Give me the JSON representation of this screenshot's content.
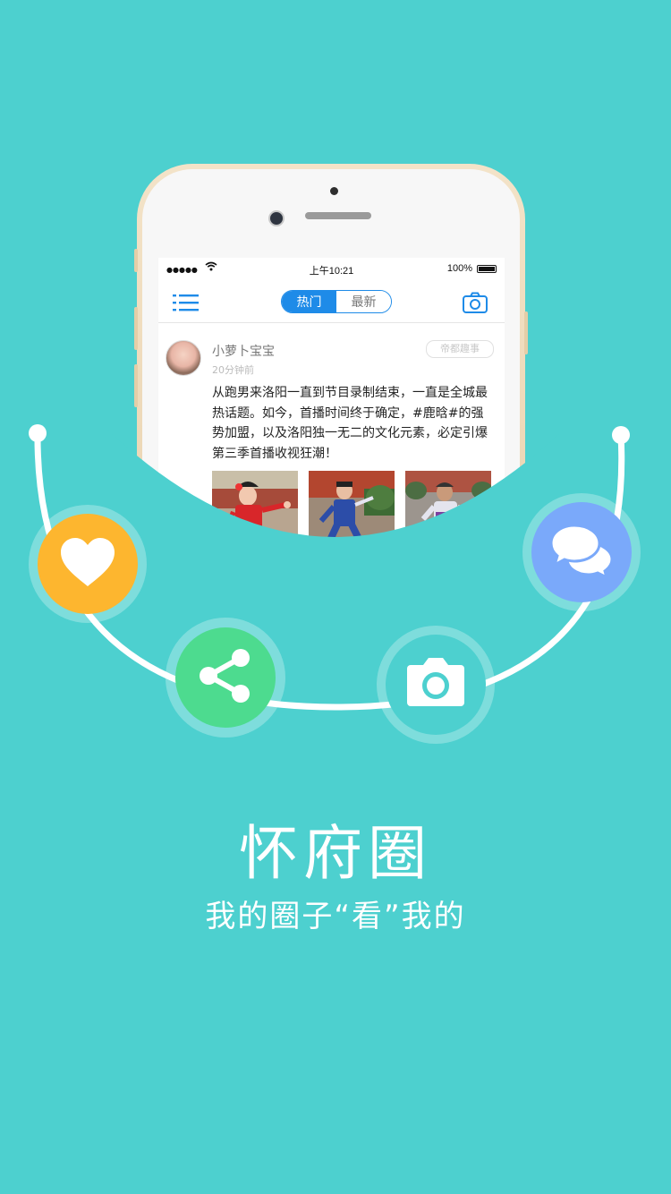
{
  "colors": {
    "background": "#4DD0CF",
    "accent_blue": "#1E8BE8",
    "heart": "#FDB62F",
    "share": "#4DDB8F",
    "chat": "#7AA9FA"
  },
  "status_bar": {
    "signal": "●●●●●",
    "wifi_icon": "wifi-icon",
    "time": "上午10:21",
    "battery": "100%"
  },
  "navbar": {
    "menu_icon": "list-icon",
    "tabs": [
      {
        "label": "热门",
        "active": true
      },
      {
        "label": "最新",
        "active": false
      }
    ],
    "camera_icon": "camera-icon"
  },
  "post": {
    "username": "小萝卜宝宝",
    "time": "20分钟前",
    "tag": "帝都趣事",
    "text": "从跑男来洛阳一直到节目录制结束，一直是全城最热话题。如今，首播时间终于确定，#鹿晗#的强势加盟，以及洛阳独一无二的文化元素，必定引爆第三季首播收视狂潮！"
  },
  "features": [
    {
      "icon": "heart-icon"
    },
    {
      "icon": "share-icon"
    },
    {
      "icon": "camera-icon"
    },
    {
      "icon": "chat-bubbles-icon"
    }
  ],
  "title": "怀府圈",
  "subtitle": "我的圈子“看”我的"
}
